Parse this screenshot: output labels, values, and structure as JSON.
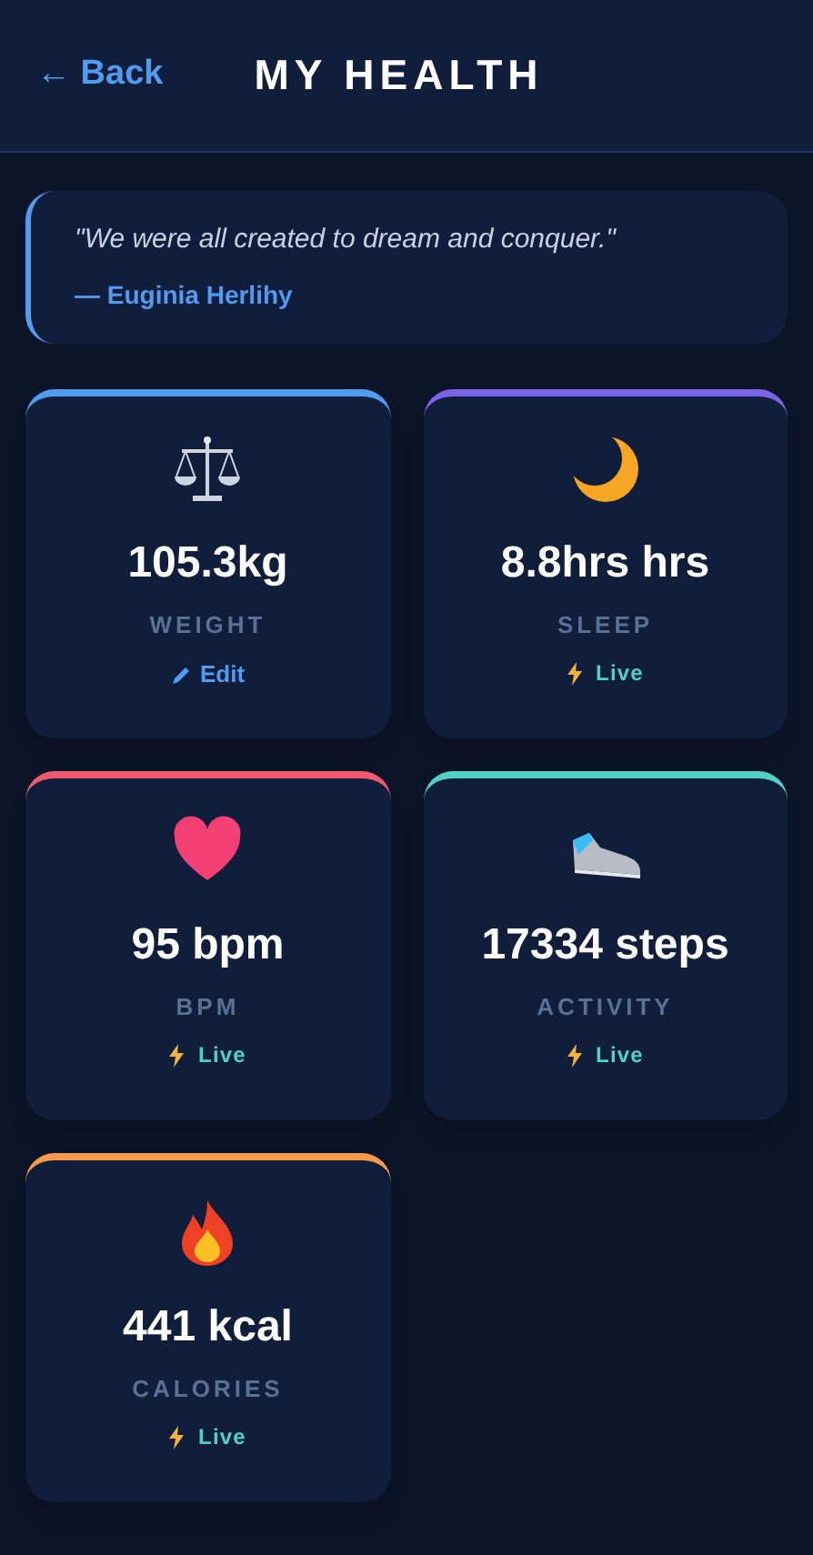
{
  "header": {
    "back": "← Back",
    "title": "MY HEALTH"
  },
  "quote": {
    "text": "\"We were all created to dream and conquer.\"",
    "author": "— Euginia Herlihy"
  },
  "cards": [
    {
      "kind": "weight",
      "color": "#4f9cf0",
      "value": "105.3kg",
      "label": "WEIGHT",
      "footer": {
        "kind": "edit",
        "text": "Edit"
      }
    },
    {
      "kind": "sleep",
      "color": "#7c62e8",
      "value": "8.8hrs hrs",
      "label": "SLEEP",
      "footer": {
        "kind": "live",
        "text": "Live"
      }
    },
    {
      "kind": "heart",
      "color": "#ef5a6f",
      "value": "95 bpm",
      "label": "BPM",
      "footer": {
        "kind": "live",
        "text": "Live"
      }
    },
    {
      "kind": "activity",
      "color": "#4fd1c5",
      "value": "17334 steps",
      "label": "ACTIVITY",
      "footer": {
        "kind": "live",
        "text": "Live"
      }
    },
    {
      "kind": "calories",
      "color": "#f6994a",
      "value": "441 kcal",
      "label": "CALORIES",
      "footer": {
        "kind": "live",
        "text": "Live"
      }
    }
  ]
}
